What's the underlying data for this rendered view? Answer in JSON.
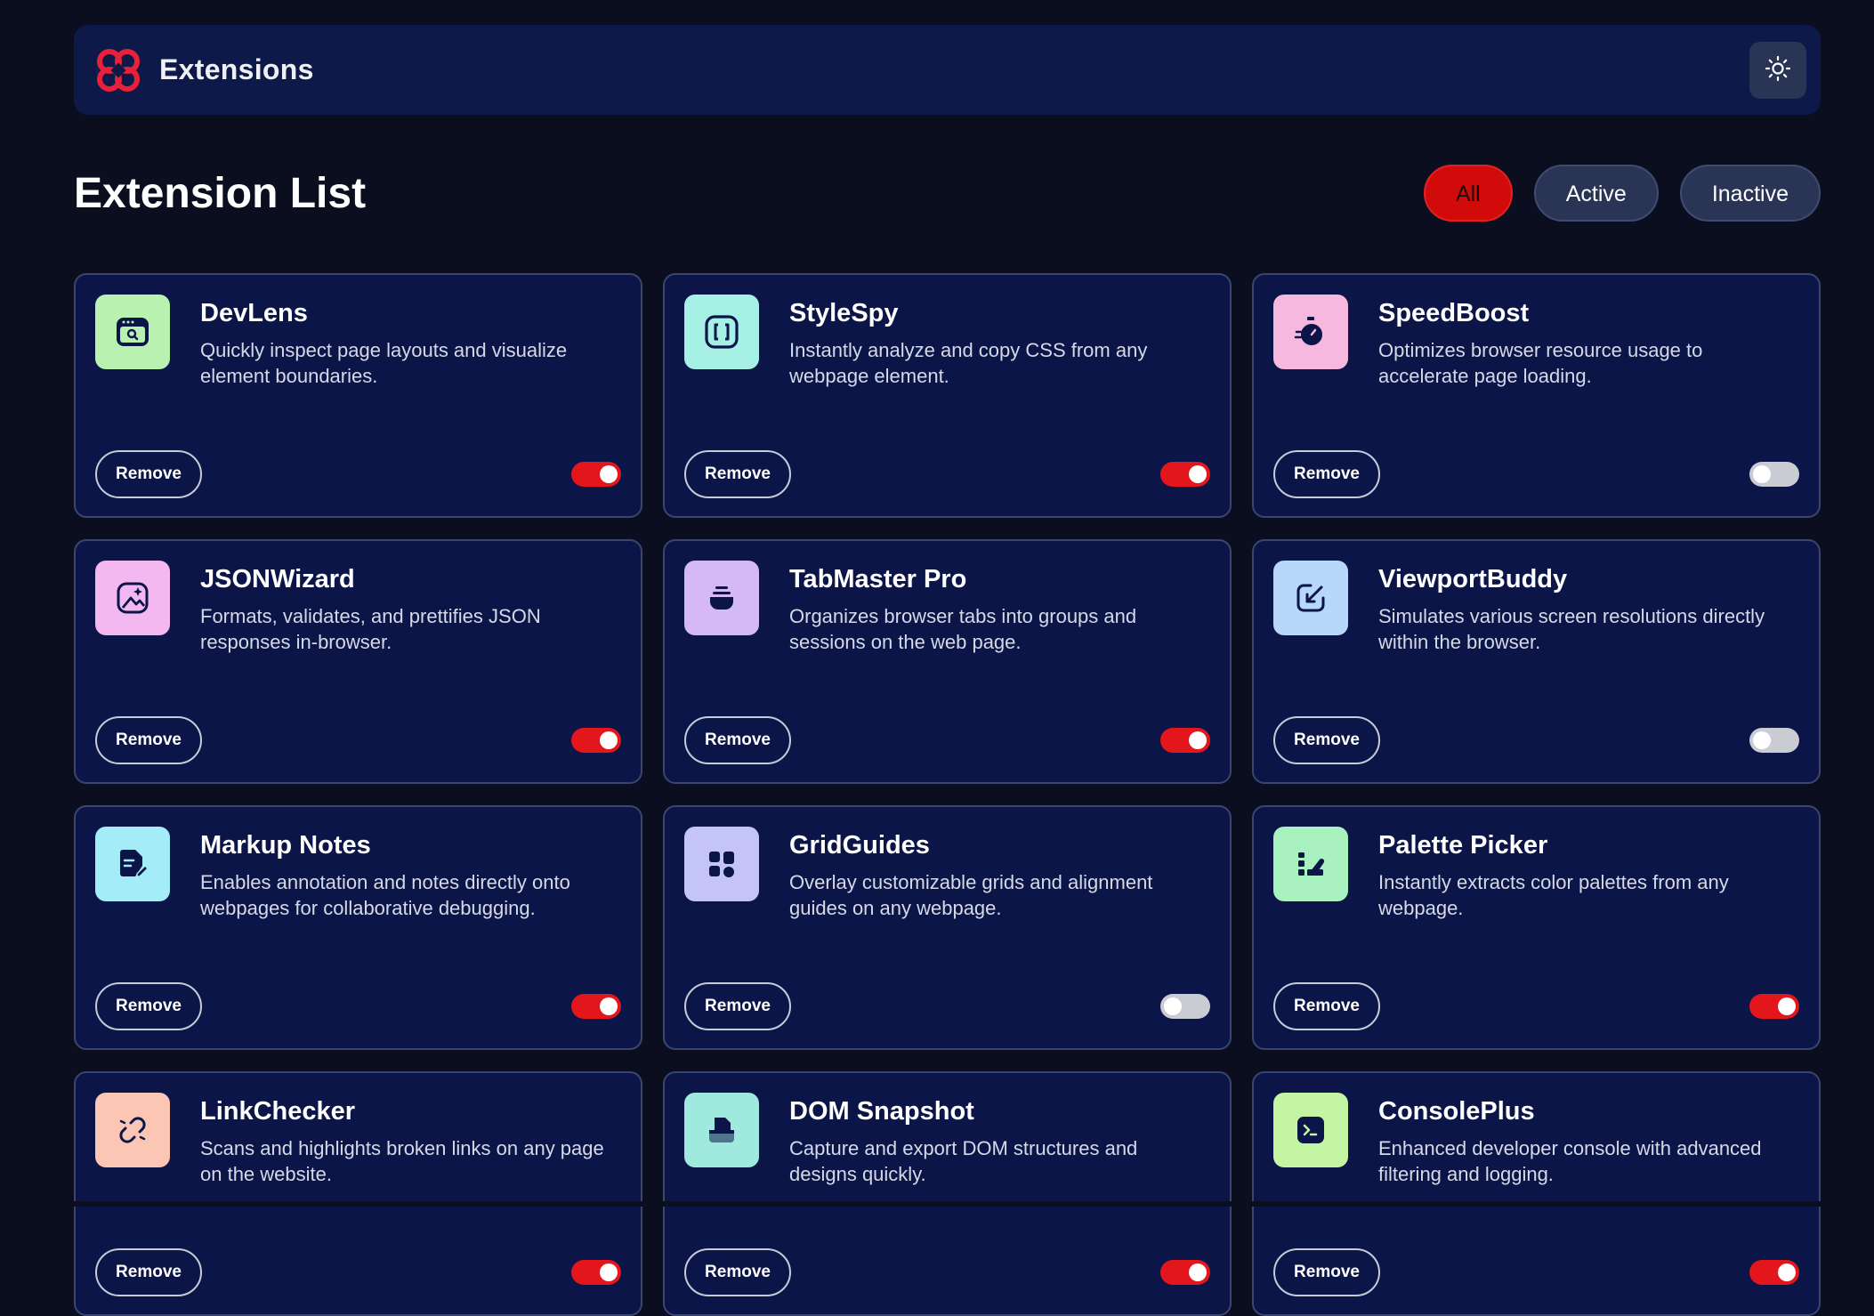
{
  "header": {
    "brand": "Extensions",
    "logo_icon": "flower-logo-icon",
    "theme_toggle_icon": "sun-icon",
    "logo_color": "#e8203a"
  },
  "main": {
    "title": "Extension List",
    "filters": [
      {
        "label": "All",
        "selected": true
      },
      {
        "label": "Active",
        "selected": false
      },
      {
        "label": "Inactive",
        "selected": false
      }
    ]
  },
  "colors": {
    "accent": "#e3161c",
    "card_bg": "#0b1548",
    "page_bg": "#0a0e1f"
  },
  "extensions": [
    {
      "name": "DevLens",
      "description": "Quickly inspect page layouts and visualize element boundaries.",
      "remove_label": "Remove",
      "active": true,
      "icon": "browser-search-icon",
      "icon_bg": "#b9f2b0"
    },
    {
      "name": "StyleSpy",
      "description": "Instantly analyze and copy CSS from any webpage element.",
      "remove_label": "Remove",
      "active": true,
      "icon": "code-bracket-icon",
      "icon_bg": "#a6f0e6"
    },
    {
      "name": "SpeedBoost",
      "description": "Optimizes browser resource usage to accelerate page loading.",
      "remove_label": "Remove",
      "active": false,
      "icon": "stopwatch-icon",
      "icon_bg": "#f7b8e0"
    },
    {
      "name": "JSONWizard",
      "description": "Formats, validates, and prettifies JSON responses in-browser.",
      "remove_label": "Remove",
      "active": true,
      "icon": "magic-image-icon",
      "icon_bg": "#f2b8ef"
    },
    {
      "name": "TabMaster Pro",
      "description": "Organizes browser tabs into groups and sessions on the web page.",
      "remove_label": "Remove",
      "active": true,
      "icon": "bowl-stack-icon",
      "icon_bg": "#d4b8f7"
    },
    {
      "name": "ViewportBuddy",
      "description": "Simulates various screen resolutions directly within the browser.",
      "remove_label": "Remove",
      "active": false,
      "icon": "expand-arrow-icon",
      "icon_bg": "#b8d8fb"
    },
    {
      "name": "Markup Notes",
      "description": "Enables annotation and notes directly onto webpages for collaborative debugging.",
      "remove_label": "Remove",
      "active": true,
      "icon": "note-edit-icon",
      "icon_bg": "#a4ecf7"
    },
    {
      "name": "GridGuides",
      "description": "Overlay customizable grids and alignment guides on any webpage.",
      "remove_label": "Remove",
      "active": false,
      "icon": "grid-blocks-icon",
      "icon_bg": "#c4c4fa"
    },
    {
      "name": "Palette Picker",
      "description": "Instantly extracts color palettes from any webpage.",
      "remove_label": "Remove",
      "active": true,
      "icon": "palette-icon",
      "icon_bg": "#a9f2c0"
    },
    {
      "name": "LinkChecker",
      "description": "Scans and highlights broken links on any page on the website.",
      "remove_label": "Remove",
      "active": true,
      "icon": "broken-link-icon",
      "icon_bg": "#fbc7b4"
    },
    {
      "name": "DOM Snapshot",
      "description": "Capture and export DOM structures and designs quickly.",
      "remove_label": "Remove",
      "active": true,
      "icon": "snapshot-icon",
      "icon_bg": "#9fe9df"
    },
    {
      "name": "ConsolePlus",
      "description": "Enhanced developer console with advanced filtering and logging.",
      "remove_label": "Remove",
      "active": true,
      "icon": "terminal-icon",
      "icon_bg": "#c4f5a2"
    }
  ]
}
